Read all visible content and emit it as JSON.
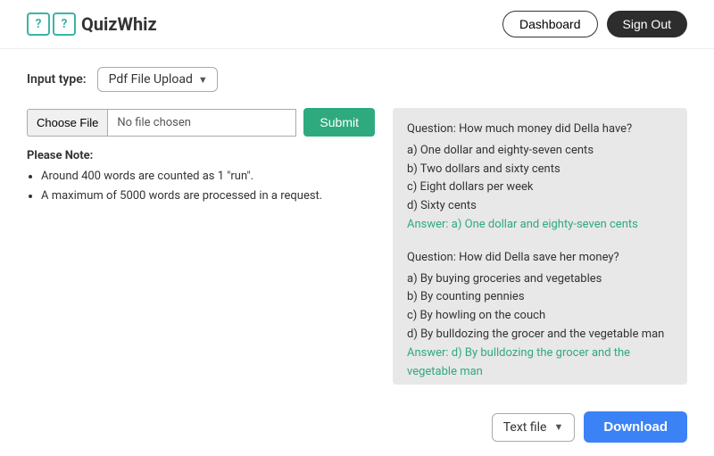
{
  "header": {
    "logo_text": "QuizWhiz",
    "logo_q1": "?",
    "logo_q2": "?",
    "dashboard_label": "Dashboard",
    "signout_label": "Sign Out"
  },
  "input_type": {
    "label": "Input type:",
    "selected": "Pdf File Upload"
  },
  "file_upload": {
    "choose_button": "Choose File",
    "file_name": "No file chosen",
    "submit_label": "Submit"
  },
  "notes": {
    "title": "Please Note:",
    "items": [
      "Around 400 words are counted as 1 \"run\".",
      "A maximum of 5000 words are processed in a request."
    ]
  },
  "quiz_output": {
    "blocks": [
      {
        "question": "Question: How much money did Della have?",
        "options": [
          "a) One dollar and eighty-seven cents",
          "b) Two dollars and sixty cents",
          "c) Eight dollars per week",
          "d) Sixty cents"
        ],
        "answer": "Answer: a) One dollar and eighty-seven cents"
      },
      {
        "question": "Question: How did Della save her money?",
        "options": [
          "a) By buying groceries and vegetables",
          "b) By counting pennies",
          "c) By howling on the couch",
          "d) By bulldozing the grocer and the vegetable man"
        ],
        "answer": "Answer: d) By bulldozing the grocer and the vegetable man"
      }
    ]
  },
  "bottom_bar": {
    "file_type_label": "Text file",
    "download_label": "Download"
  }
}
